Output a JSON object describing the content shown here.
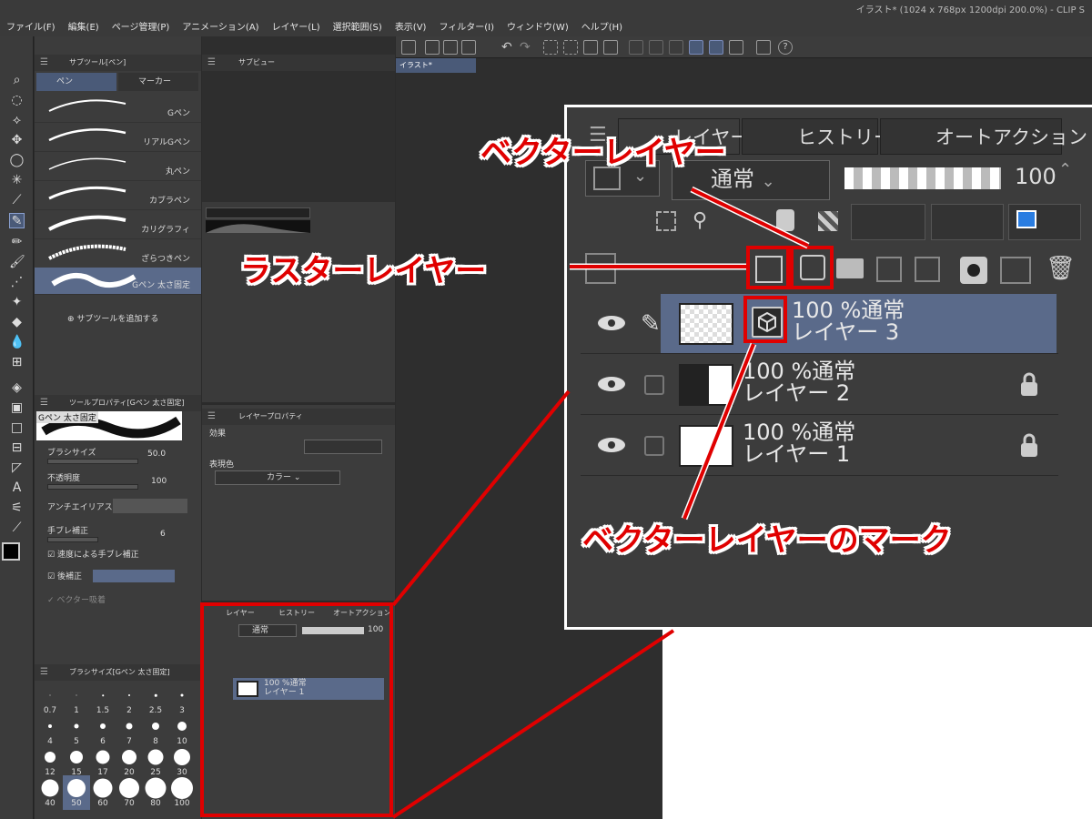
{
  "window": {
    "title": "イラスト* (1024 x 768px 1200dpi 200.0%) - CLIP S"
  },
  "menu": [
    "ファイル(F)",
    "編集(E)",
    "ページ管理(P)",
    "アニメーション(A)",
    "レイヤー(L)",
    "選択範囲(S)",
    "表示(V)",
    "フィルター(I)",
    "ウィンドウ(W)",
    "ヘルプ(H)"
  ],
  "subtool": {
    "title": "サブツール[ペン]",
    "tabs": [
      "ペン",
      "マーカー"
    ],
    "items": [
      "Gペン",
      "リアルGペン",
      "丸ペン",
      "カブラペン",
      "カリグラフィ",
      "ざらつきペン",
      "Gペン 太さ固定"
    ],
    "add_label": "サブツールを追加する"
  },
  "subview": {
    "title": "サブビュー"
  },
  "toolprop": {
    "title": "ツールプロパティ[Gペン 太さ固定]",
    "preset": "Gペン 太さ固定",
    "brush_size_label": "ブラシサイズ",
    "brush_size_value": "50.0",
    "opacity_label": "不透明度",
    "opacity_value": "100",
    "aa_label": "アンチエイリアス",
    "stab_label": "手ブレ補正",
    "stab_value": "6",
    "speed_label": "速度による手ブレ補正",
    "post_label": "後補正",
    "vector_label": "ベクター吸着"
  },
  "brushsize": {
    "title": "ブラシサイズ[Gペン 太さ固定]",
    "sizes": [
      "0.7",
      "1",
      "1.5",
      "2",
      "2.5",
      "3",
      "4",
      "5",
      "6",
      "7",
      "8",
      "10",
      "12",
      "15",
      "17",
      "20",
      "25",
      "30",
      "40",
      "50",
      "60",
      "70",
      "80",
      "100"
    ]
  },
  "layprop": {
    "title": "レイヤープロパティ",
    "effect_label": "効果",
    "color_label": "表現色",
    "color_value": "カラー"
  },
  "small_layer": {
    "tabs": [
      "レイヤー",
      "ヒストリー",
      "オートアクション"
    ],
    "blend": "通常",
    "opacity": "100",
    "layer_pct": "100 %通常",
    "layer_name": "レイヤー 1"
  },
  "canvas": {
    "doc_tab": "イラスト*"
  },
  "zoom": {
    "tabs": [
      "レイヤー",
      "ヒストリー",
      "オートアクション"
    ],
    "blend": "通常",
    "opacity": "100",
    "layers": [
      {
        "pct": "100 %通常",
        "name": "レイヤー 3"
      },
      {
        "pct": "100 %通常",
        "name": "レイヤー 2"
      },
      {
        "pct": "100 %通常",
        "name": "レイヤー 1"
      }
    ]
  },
  "annotations": {
    "vector": "ベクターレイヤー",
    "raster": "ラスターレイヤー",
    "vector_mark": "ベクターレイヤーのマーク"
  },
  "colors": {
    "accent": "#e00000",
    "selection": "#5a6a8a",
    "panel": "#3c3c3c"
  }
}
